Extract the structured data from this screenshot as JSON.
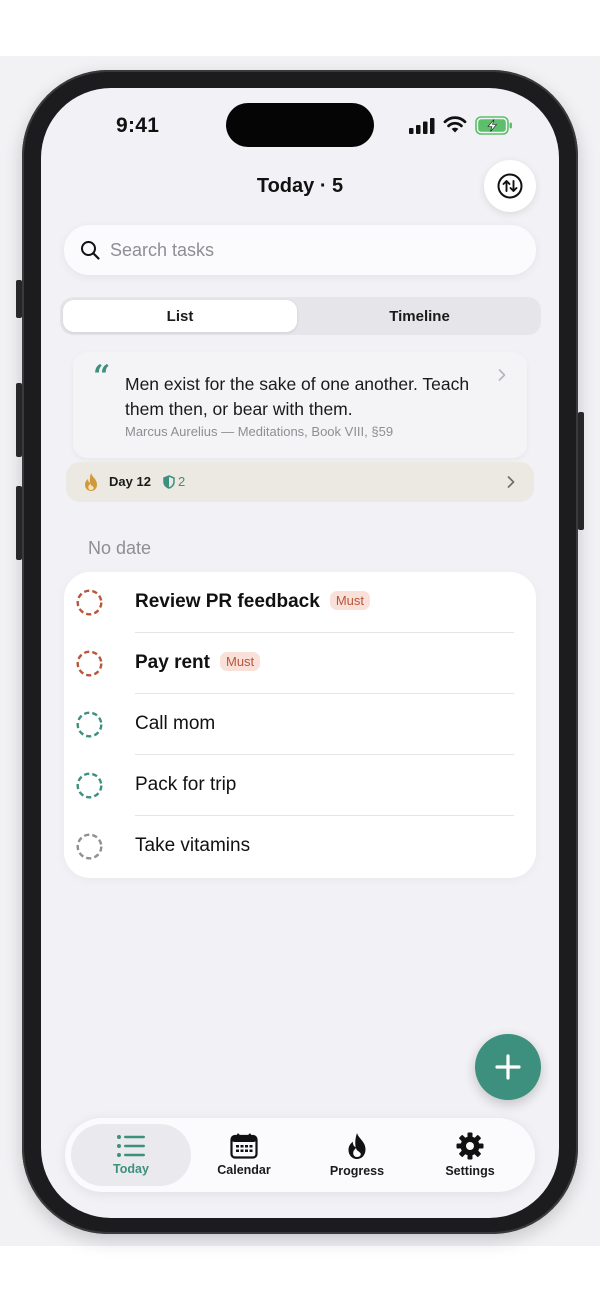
{
  "status": {
    "time": "9:41"
  },
  "header": {
    "title": "Today · 5"
  },
  "search": {
    "placeholder": "Search tasks",
    "value": ""
  },
  "view_toggle": {
    "options": [
      "List",
      "Timeline"
    ],
    "selected": "List"
  },
  "quote": {
    "text": "Men exist for the sake of one another. Teach them then, or bear with them.",
    "source": "Marcus Aurelius — Meditations, Book VIII, §59"
  },
  "streak": {
    "day_label": "Day 12",
    "shield_count": "2"
  },
  "section": {
    "label": "No date"
  },
  "tasks": [
    {
      "title": "Review PR feedback",
      "badge": "Must",
      "priority": "must"
    },
    {
      "title": "Pay rent",
      "badge": "Must",
      "priority": "must"
    },
    {
      "title": "Call mom",
      "badge": "",
      "priority": "normal"
    },
    {
      "title": "Pack for trip",
      "badge": "",
      "priority": "normal"
    },
    {
      "title": "Take vitamins",
      "badge": "",
      "priority": "low"
    }
  ],
  "tab_bar": {
    "items": [
      {
        "label": "Today",
        "icon": "list-icon",
        "active": true
      },
      {
        "label": "Calendar",
        "icon": "calendar-icon",
        "active": false
      },
      {
        "label": "Progress",
        "icon": "flame-icon",
        "active": false
      },
      {
        "label": "Settings",
        "icon": "gear-icon",
        "active": false
      }
    ]
  },
  "colors": {
    "accent": "#3d8f7e",
    "must": "#b8553a",
    "must_badge_bg": "#f9e1da",
    "low": "#8e8e93"
  }
}
